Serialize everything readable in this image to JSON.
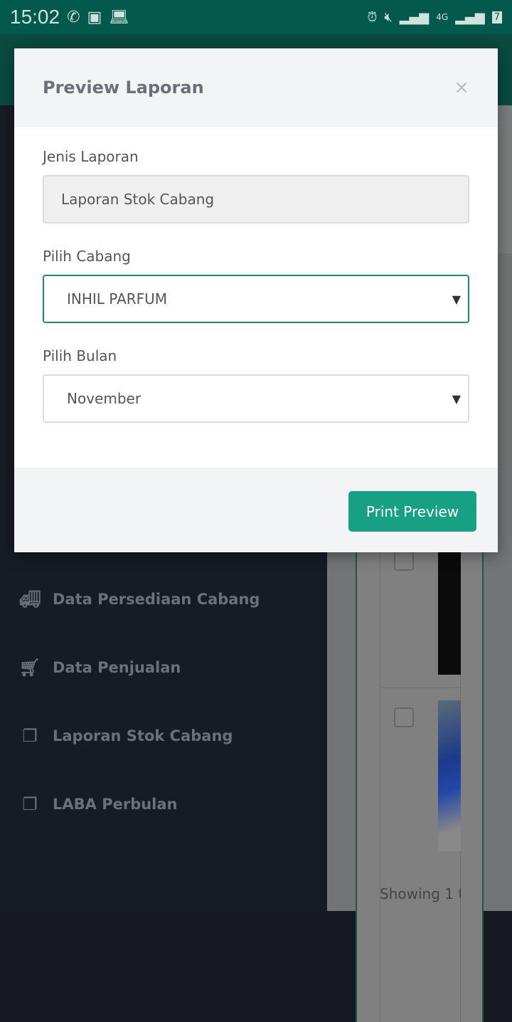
{
  "status_bar": {
    "time": "15:02",
    "network": "4G",
    "battery": "7"
  },
  "sidebar": {
    "items": [
      {
        "label": "Data Persediaan Cabang",
        "icon": "truck-icon"
      },
      {
        "label": "Data Penjualan",
        "icon": "cart-icon"
      },
      {
        "label": "Laporan Stok Cabang",
        "icon": "file-copy-icon"
      },
      {
        "label": "LABA Perbulan",
        "icon": "file-copy-icon"
      }
    ]
  },
  "content": {
    "showing": "Showing 1 t"
  },
  "modal": {
    "title": "Preview Laporan",
    "close": "×",
    "jenis_label": "Jenis Laporan",
    "jenis_value": "Laporan Stok Cabang",
    "cabang_label": "Pilih Cabang",
    "cabang_value": "INHIL PARFUM",
    "bulan_label": "Pilih Bulan",
    "bulan_value": "November",
    "button": "Print Preview"
  },
  "colors": {
    "accent": "#18a085",
    "status_bar": "#03594b"
  }
}
